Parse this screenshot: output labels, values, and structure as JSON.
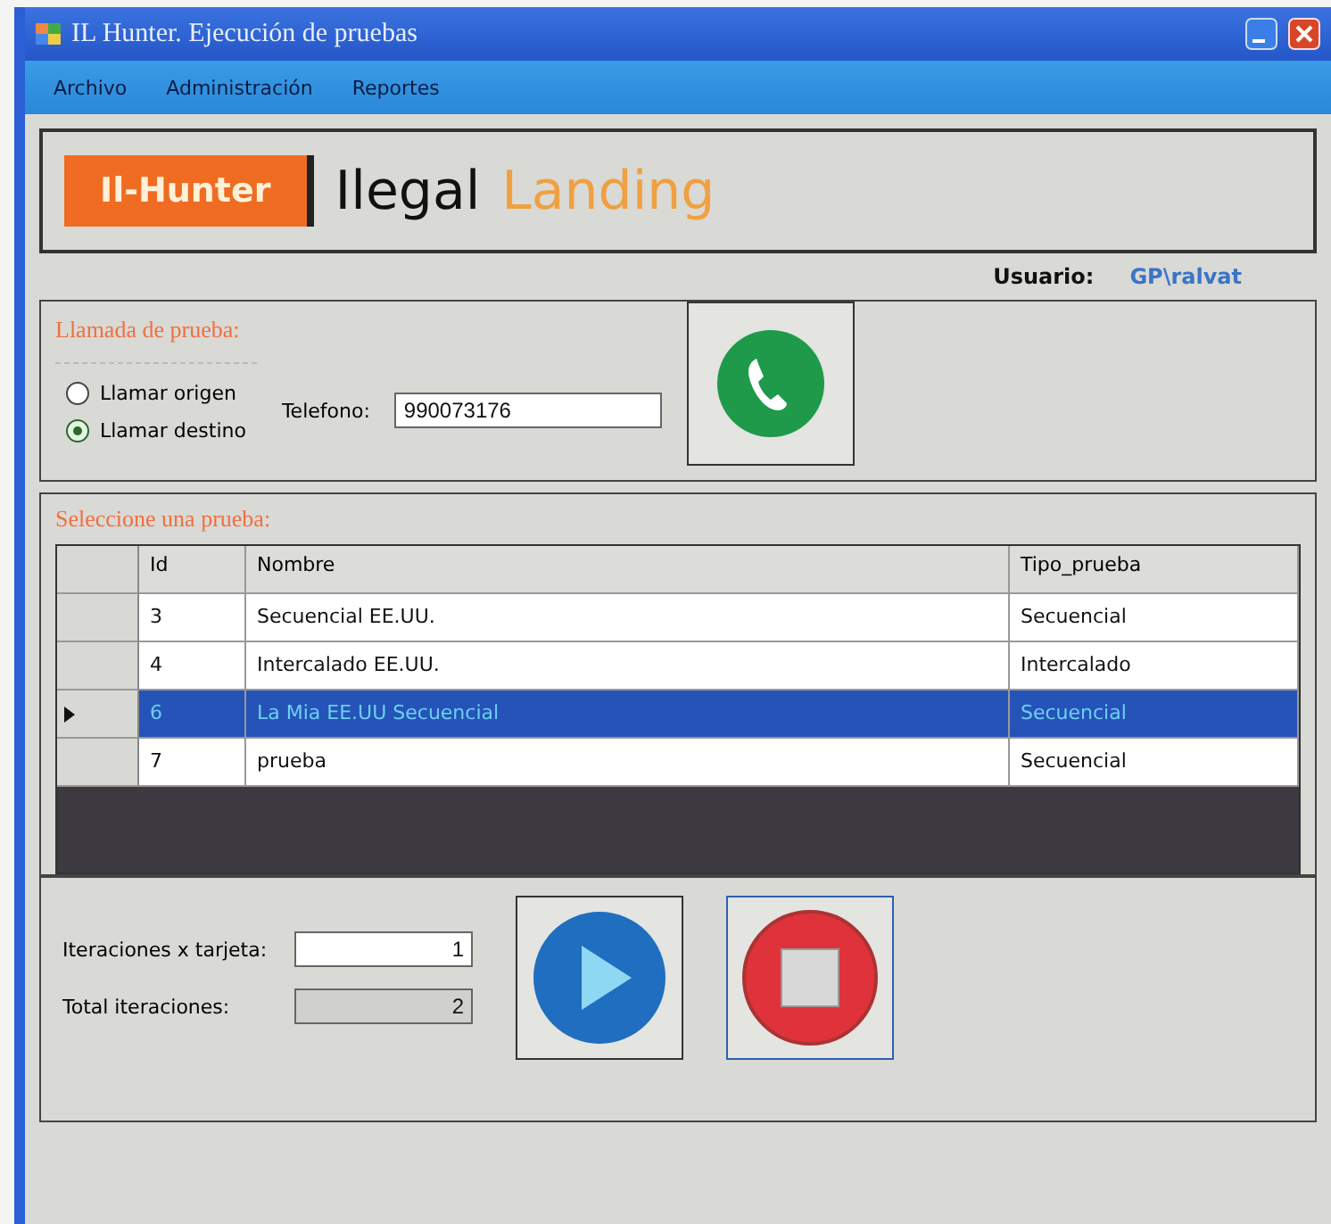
{
  "window": {
    "title": "IL Hunter. Ejecución de pruebas"
  },
  "menu": [
    "Archivo",
    "Administración",
    "Reportes"
  ],
  "banner": {
    "logo": "Il-Hunter",
    "title": "Ilegal",
    "subtitle": "Landing"
  },
  "user": {
    "label": "Usuario:",
    "value": "GP\\ralvat"
  },
  "call_group": {
    "title": "Llamada de prueba:",
    "options": [
      {
        "label": "Llamar origen",
        "selected": false
      },
      {
        "label": "Llamar destino",
        "selected": true
      }
    ],
    "phone_label": "Telefono:",
    "phone_value": "990073176"
  },
  "tests": {
    "title": "Seleccione una prueba:",
    "columns": [
      "Id",
      "Nombre",
      "Tipo_prueba"
    ],
    "rows": [
      {
        "cells": [
          "3",
          "Secuencial EE.UU.",
          "Secuencial"
        ],
        "selected": false
      },
      {
        "cells": [
          "4",
          "Intercalado EE.UU.",
          "Intercalado"
        ],
        "selected": false
      },
      {
        "cells": [
          "6",
          "La Mia EE.UU Secuencial",
          "Secuencial"
        ],
        "selected": true
      },
      {
        "cells": [
          "7",
          "prueba",
          "Secuencial"
        ],
        "selected": false
      }
    ]
  },
  "iterations": [
    {
      "label": "Iteraciones x tarjeta:",
      "value": "1",
      "disabled": false
    },
    {
      "label": "Total iteraciones:",
      "value": "2",
      "disabled": true
    }
  ]
}
